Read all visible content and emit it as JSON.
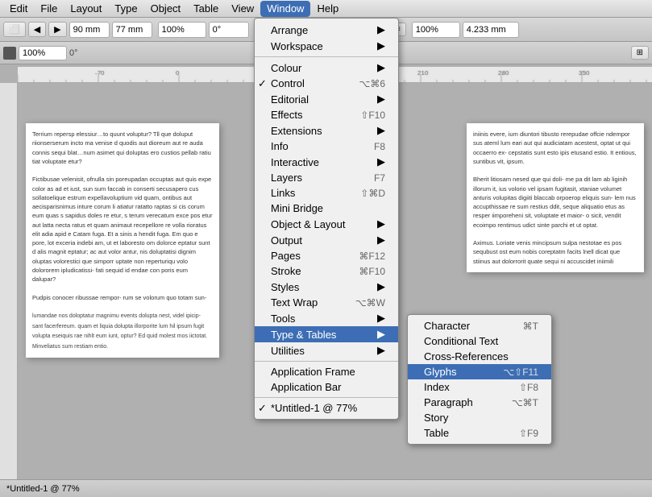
{
  "menubar": {
    "items": [
      "Edit",
      "File",
      "Layout",
      "Type",
      "Object",
      "Table",
      "View",
      "Window",
      "Help"
    ],
    "active": "Window"
  },
  "window_menu": {
    "items": [
      {
        "label": "Arrange",
        "shortcut": "",
        "arrow": true,
        "separator": false,
        "check": false,
        "active": false
      },
      {
        "label": "Workspace",
        "shortcut": "",
        "arrow": true,
        "separator": false,
        "check": false,
        "active": false
      },
      {
        "label": "",
        "separator": true
      },
      {
        "label": "Colour",
        "shortcut": "",
        "arrow": false,
        "separator": false,
        "check": false,
        "active": false
      },
      {
        "label": "Control",
        "shortcut": "⌥⌘6",
        "arrow": false,
        "separator": false,
        "check": true,
        "active": false
      },
      {
        "label": "Editorial",
        "shortcut": "",
        "arrow": true,
        "separator": false,
        "check": false,
        "active": false
      },
      {
        "label": "Effects",
        "shortcut": "⇧F10",
        "arrow": false,
        "separator": false,
        "check": false,
        "active": false
      },
      {
        "label": "Extensions",
        "shortcut": "",
        "arrow": true,
        "separator": false,
        "check": false,
        "active": false
      },
      {
        "label": "Info",
        "shortcut": "F8",
        "arrow": false,
        "separator": false,
        "check": false,
        "active": false
      },
      {
        "label": "Interactive",
        "shortcut": "",
        "arrow": true,
        "separator": false,
        "check": false,
        "active": false
      },
      {
        "label": "Layers",
        "shortcut": "F7",
        "arrow": false,
        "separator": false,
        "check": false,
        "active": false
      },
      {
        "label": "Links",
        "shortcut": "⇧⌘D",
        "arrow": false,
        "separator": false,
        "check": false,
        "active": false
      },
      {
        "label": "Mini Bridge",
        "shortcut": "",
        "arrow": false,
        "separator": false,
        "check": false,
        "active": false
      },
      {
        "label": "Object & Layout",
        "shortcut": "",
        "arrow": true,
        "separator": false,
        "check": false,
        "active": false
      },
      {
        "label": "Output",
        "shortcut": "",
        "arrow": true,
        "separator": false,
        "check": false,
        "active": false
      },
      {
        "label": "Pages",
        "shortcut": "⌘F12",
        "arrow": false,
        "separator": false,
        "check": false,
        "active": false
      },
      {
        "label": "Stroke",
        "shortcut": "⌘F10",
        "arrow": false,
        "separator": false,
        "check": false,
        "active": false
      },
      {
        "label": "Styles",
        "shortcut": "",
        "arrow": true,
        "separator": false,
        "check": false,
        "active": false
      },
      {
        "label": "Text Wrap",
        "shortcut": "⌥⌘W",
        "arrow": false,
        "separator": false,
        "check": false,
        "active": false
      },
      {
        "label": "Tools",
        "shortcut": "",
        "arrow": true,
        "separator": false,
        "check": false,
        "active": false
      },
      {
        "label": "Type & Tables",
        "shortcut": "",
        "arrow": true,
        "separator": false,
        "check": false,
        "active": true
      },
      {
        "label": "Utilities",
        "shortcut": "",
        "arrow": true,
        "separator": false,
        "check": false,
        "active": false
      },
      {
        "label": "",
        "separator": true
      },
      {
        "label": "Application Frame",
        "shortcut": "",
        "arrow": false,
        "separator": false,
        "check": false,
        "active": false
      },
      {
        "label": "Application Bar",
        "shortcut": "",
        "arrow": false,
        "separator": false,
        "check": false,
        "active": false
      },
      {
        "label": "",
        "separator": true
      },
      {
        "label": "✓ *Untitled-1 @ 77%",
        "shortcut": "",
        "arrow": false,
        "separator": false,
        "check": false,
        "active": false
      }
    ]
  },
  "typetables_submenu": {
    "items": [
      {
        "label": "Character",
        "shortcut": "⌘T",
        "active": false
      },
      {
        "label": "Conditional Text",
        "shortcut": "",
        "active": false
      },
      {
        "label": "Cross-References",
        "shortcut": "",
        "active": false
      },
      {
        "label": "Glyphs",
        "shortcut": "⌥⇧F11",
        "active": true
      },
      {
        "label": "Index",
        "shortcut": "⇧F8",
        "active": false
      },
      {
        "label": "Paragraph",
        "shortcut": "⌥⌘T",
        "active": false
      },
      {
        "label": "Story",
        "shortcut": "",
        "active": false
      },
      {
        "label": "Table",
        "shortcut": "⇧F9",
        "active": false
      }
    ]
  },
  "doc_text": "Terrium repersp elessiur…\n…to quunt voluptur? The\nquae doluput riionser se\nderum incto ma venise d\nquodis aut dioreum aut re\nauda connis sequi blat…\nnum asimet qui doluptas\nero custios pellab ratiu\ntiat voluptate etur?\n\nFictibusae velenisit, of\n...",
  "statusbar": {
    "doc_info": "*Untitled-1 @ 77%"
  },
  "toolbar": {
    "zoom": "100%",
    "rotation": "0°"
  }
}
